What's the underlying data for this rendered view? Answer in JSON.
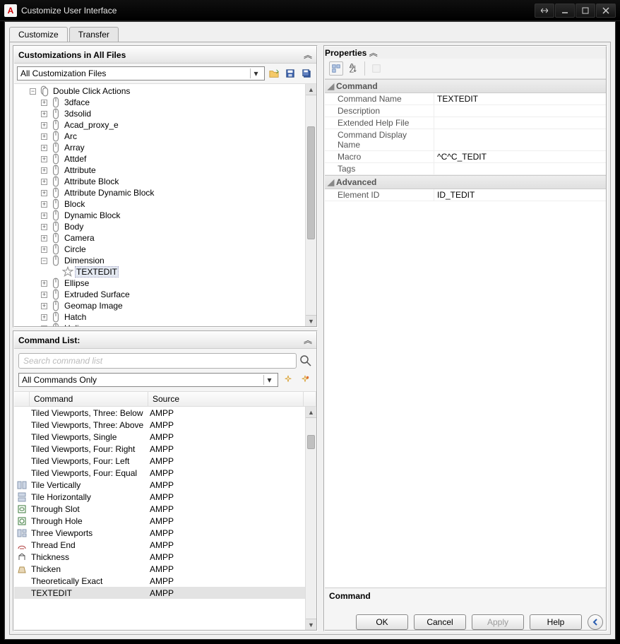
{
  "window_title": "Customize User Interface",
  "tabs": {
    "customize": "Customize",
    "transfer": "Transfer"
  },
  "left": {
    "pane1_title": "Customizations in All Files",
    "dd_all_files": "All Customization Files",
    "tree": {
      "root": "Double Click Actions",
      "children": [
        "3dface",
        "3dsolid",
        "Acad_proxy_e",
        "Arc",
        "Array",
        "Attdef",
        "Attribute",
        "Attribute Block",
        "Attribute Dynamic Block",
        "Block",
        "Dynamic Block",
        "Body",
        "Camera",
        "Circle",
        "Dimension",
        "Ellipse",
        "Extruded Surface",
        "Geomap Image",
        "Hatch",
        "Helix"
      ],
      "dimension_child": "TEXTEDIT"
    },
    "pane2_title": "Command List:",
    "search_placeholder": "Search command list",
    "dd_filter": "All Commands Only",
    "grid_headers": {
      "c1": "Command",
      "c2": "Source"
    },
    "rows": [
      {
        "icon": "",
        "cmd": "Tiled Viewports, Three: Below",
        "src": "AMPP"
      },
      {
        "icon": "",
        "cmd": "Tiled Viewports, Three: Above",
        "src": "AMPP"
      },
      {
        "icon": "",
        "cmd": "Tiled Viewports, Single",
        "src": "AMPP"
      },
      {
        "icon": "",
        "cmd": "Tiled Viewports, Four:  Right",
        "src": "AMPP"
      },
      {
        "icon": "",
        "cmd": "Tiled Viewports, Four:  Left",
        "src": "AMPP"
      },
      {
        "icon": "",
        "cmd": "Tiled Viewports, Four:  Equal",
        "src": "AMPP"
      },
      {
        "icon": "tv",
        "cmd": "Tile Vertically",
        "src": "AMPP"
      },
      {
        "icon": "th",
        "cmd": "Tile Horizontally",
        "src": "AMPP"
      },
      {
        "icon": "slot",
        "cmd": "Through Slot",
        "src": "AMPP"
      },
      {
        "icon": "hole",
        "cmd": "Through Hole",
        "src": "AMPP"
      },
      {
        "icon": "vp3",
        "cmd": "Three Viewports",
        "src": "AMPP"
      },
      {
        "icon": "thr",
        "cmd": "Thread End",
        "src": "AMPP"
      },
      {
        "icon": "thk",
        "cmd": "Thickness",
        "src": "AMPP"
      },
      {
        "icon": "thn",
        "cmd": "Thicken",
        "src": "AMPP"
      },
      {
        "icon": "",
        "cmd": "Theoretically Exact",
        "src": "AMPP"
      },
      {
        "icon": "",
        "cmd": "TEXTEDIT",
        "src": "AMPP",
        "sel": true
      }
    ]
  },
  "right": {
    "pane_title": "Properties",
    "cats": {
      "command": "Command",
      "advanced": "Advanced"
    },
    "rows": {
      "command_name_k": "Command Name",
      "command_name_v": "TEXTEDIT",
      "description_k": "Description",
      "description_v": "",
      "ehf_k": "Extended Help File",
      "ehf_v": "",
      "cdn_k": "Command Display Name",
      "cdn_v": "",
      "macro_k": "Macro",
      "macro_v": "^C^C_TEDIT",
      "tags_k": "Tags",
      "tags_v": "",
      "elid_k": "Element ID",
      "elid_v": "ID_TEDIT"
    },
    "desc_header": "Command"
  },
  "buttons": {
    "ok": "OK",
    "cancel": "Cancel",
    "apply": "Apply",
    "help": "Help"
  }
}
